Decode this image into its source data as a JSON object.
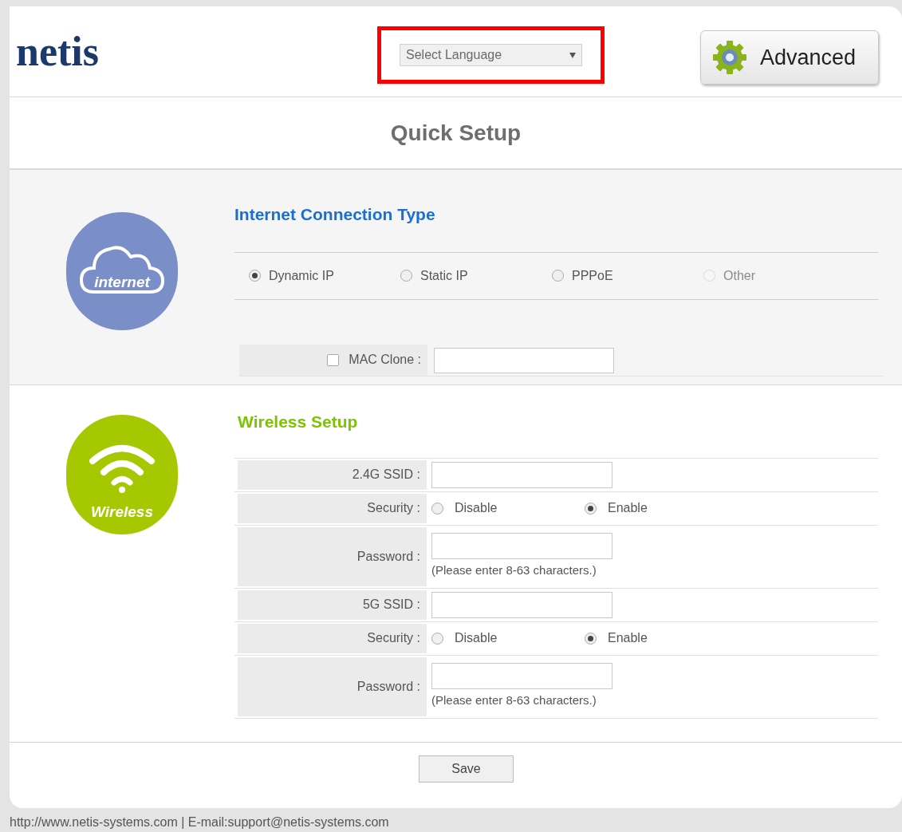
{
  "header": {
    "logo": "netis",
    "language_select": {
      "value": "Select Language",
      "highlighted": true
    },
    "advanced_button": "Advanced"
  },
  "title": "Quick Setup",
  "internet": {
    "icon_label": "internet",
    "heading": "Internet Connection Type",
    "options": [
      {
        "label": "Dynamic IP",
        "selected": true,
        "disabled": false
      },
      {
        "label": "Static IP",
        "selected": false,
        "disabled": false
      },
      {
        "label": "PPPoE",
        "selected": false,
        "disabled": false
      },
      {
        "label": "Other",
        "selected": false,
        "disabled": true
      }
    ],
    "mac_clone": {
      "label": "MAC Clone :",
      "checked": false
    }
  },
  "wireless": {
    "icon_label": "Wireless",
    "heading": "Wireless Setup",
    "rows": [
      {
        "kind": "text",
        "label": "2.4G SSID :"
      },
      {
        "kind": "radio",
        "label": "Security :",
        "options": [
          {
            "label": "Disable",
            "selected": false
          },
          {
            "label": "Enable",
            "selected": true
          }
        ]
      },
      {
        "kind": "password",
        "label": "Password :",
        "hint": "(Please enter 8-63 characters.)"
      },
      {
        "kind": "text",
        "label": "5G SSID :"
      },
      {
        "kind": "radio",
        "label": "Security :",
        "options": [
          {
            "label": "Disable",
            "selected": false
          },
          {
            "label": "Enable",
            "selected": true
          }
        ]
      },
      {
        "kind": "password",
        "label": "Password :",
        "hint": "(Please enter 8-63 characters.)"
      }
    ]
  },
  "save_button": "Save",
  "footer": "http://www.netis-systems.com | E-mail:support@netis-systems.com"
}
